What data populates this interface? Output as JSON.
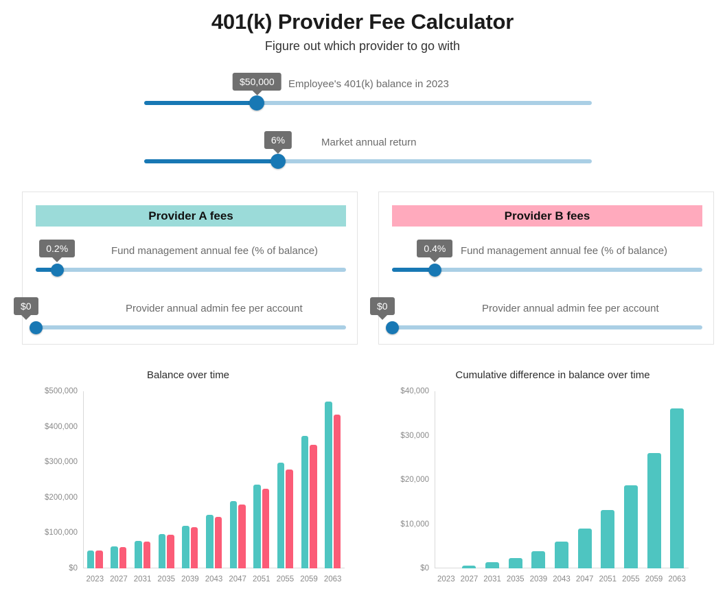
{
  "header": {
    "title": "401(k) Provider Fee Calculator",
    "subtitle": "Figure out which provider to go with"
  },
  "controls": [
    {
      "name": "balance",
      "label": "Employee's 401(k) balance in 2023",
      "value_text": "$50,000",
      "fill_pct": 25.2
    },
    {
      "name": "market-return",
      "label": "Market annual return",
      "value_text": "6%",
      "fill_pct": 29.9
    }
  ],
  "providers": [
    {
      "id": "a",
      "heading": "Provider A fees",
      "accent": "#9bdbd9",
      "fees": [
        {
          "name": "fund-management-fee",
          "label": "Fund management annual fee (% of balance)",
          "value_text": "0.2%",
          "fill_pct": 6.9
        },
        {
          "name": "admin-fee",
          "label": "Provider annual admin fee per account",
          "value_text": "$0",
          "fill_pct": 0
        }
      ]
    },
    {
      "id": "b",
      "heading": "Provider B fees",
      "accent": "#ffaabd",
      "fees": [
        {
          "name": "fund-management-fee",
          "label": "Fund management annual fee (% of balance)",
          "value_text": "0.4%",
          "fill_pct": 13.8
        },
        {
          "name": "admin-fee",
          "label": "Provider annual admin fee per account",
          "value_text": "$0",
          "fill_pct": 0
        }
      ]
    }
  ],
  "colors": {
    "provider_a_bar": "#4ec5c1",
    "provider_b_bar": "#fb5c77",
    "provider_a_header": "#9bdbd9",
    "provider_b_header": "#ffaabd",
    "slider_fill": "#1878b4",
    "slider_track": "#aacfe5",
    "bubble": "#6f6f6f"
  },
  "chart_data": [
    {
      "type": "bar",
      "title": "Balance over time",
      "xlabel": "",
      "ylabel": "",
      "ylim": [
        0,
        500000
      ],
      "yticks": [
        "$0",
        "$100,000",
        "$200,000",
        "$300,000",
        "$400,000",
        "$500,000"
      ],
      "ytick_values": [
        0,
        100000,
        200000,
        300000,
        400000,
        500000
      ],
      "grid": false,
      "legend": "none",
      "categories": [
        "2023",
        "2027",
        "2031",
        "2035",
        "2039",
        "2043",
        "2047",
        "2051",
        "2055",
        "2059",
        "2063"
      ],
      "series": [
        {
          "name": "Provider A",
          "color": "#4ec5c1",
          "values": [
            50000,
            62000,
            78000,
            97000,
            121000,
            151000,
            189000,
            237000,
            298000,
            375000,
            471000
          ]
        },
        {
          "name": "Provider B",
          "color": "#fb5c77",
          "values": [
            50000,
            61000,
            76000,
            95000,
            117000,
            145000,
            180000,
            224000,
            279000,
            349000,
            435000
          ]
        }
      ]
    },
    {
      "type": "bar",
      "title": "Cumulative difference in balance over time",
      "xlabel": "",
      "ylabel": "",
      "ylim": [
        0,
        40000
      ],
      "yticks": [
        "$0",
        "$10,000",
        "$20,000",
        "$30,000",
        "$40,000"
      ],
      "ytick_values": [
        0,
        10000,
        20000,
        30000,
        40000
      ],
      "grid": false,
      "legend": "none",
      "categories": [
        "2023",
        "2027",
        "2031",
        "2035",
        "2039",
        "2043",
        "2047",
        "2051",
        "2055",
        "2059",
        "2063"
      ],
      "series": [
        {
          "name": "Difference",
          "color": "#4ec5c1",
          "values": [
            0,
            600,
            1400,
            2400,
            3900,
            6000,
            9000,
            13200,
            18800,
            26000,
            36200
          ]
        }
      ]
    }
  ]
}
